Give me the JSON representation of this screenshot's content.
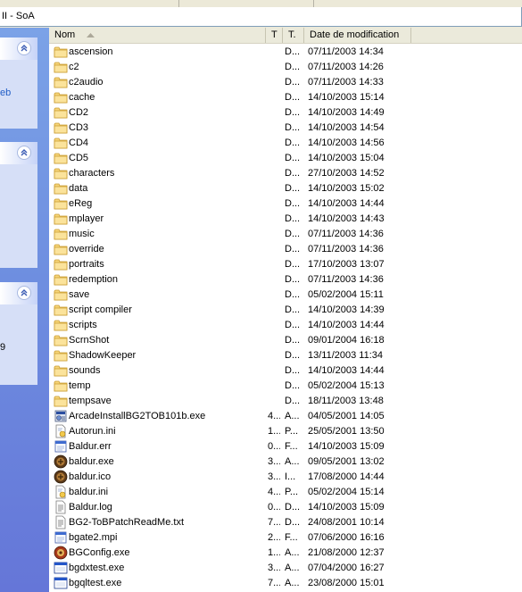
{
  "window": {
    "address_text": "II - SoA"
  },
  "task_pane": {
    "sections": [
      {
        "chevron": "chevron-up-icon",
        "text": "eb"
      },
      {
        "chevron": "chevron-up-icon",
        "text": ""
      },
      {
        "chevron": "chevron-up-icon",
        "text": "9"
      }
    ]
  },
  "columns": {
    "name": "Nom",
    "size": "T",
    "type": "T.",
    "date": "Date de modification"
  },
  "files": [
    {
      "name": "ascension",
      "size": "",
      "type": "D...",
      "date": "07/11/2003 14:34",
      "icon": "folder-icon"
    },
    {
      "name": "c2",
      "size": "",
      "type": "D...",
      "date": "07/11/2003 14:26",
      "icon": "folder-icon"
    },
    {
      "name": "c2audio",
      "size": "",
      "type": "D...",
      "date": "07/11/2003 14:33",
      "icon": "folder-icon"
    },
    {
      "name": "cache",
      "size": "",
      "type": "D...",
      "date": "14/10/2003 15:14",
      "icon": "folder-icon"
    },
    {
      "name": "CD2",
      "size": "",
      "type": "D...",
      "date": "14/10/2003 14:49",
      "icon": "folder-icon"
    },
    {
      "name": "CD3",
      "size": "",
      "type": "D...",
      "date": "14/10/2003 14:54",
      "icon": "folder-icon"
    },
    {
      "name": "CD4",
      "size": "",
      "type": "D...",
      "date": "14/10/2003 14:56",
      "icon": "folder-icon"
    },
    {
      "name": "CD5",
      "size": "",
      "type": "D...",
      "date": "14/10/2003 15:04",
      "icon": "folder-icon"
    },
    {
      "name": "characters",
      "size": "",
      "type": "D...",
      "date": "27/10/2003 14:52",
      "icon": "folder-icon"
    },
    {
      "name": "data",
      "size": "",
      "type": "D...",
      "date": "14/10/2003 15:02",
      "icon": "folder-icon"
    },
    {
      "name": "eReg",
      "size": "",
      "type": "D...",
      "date": "14/10/2003 14:44",
      "icon": "folder-icon"
    },
    {
      "name": "mplayer",
      "size": "",
      "type": "D...",
      "date": "14/10/2003 14:43",
      "icon": "folder-icon"
    },
    {
      "name": "music",
      "size": "",
      "type": "D...",
      "date": "07/11/2003 14:36",
      "icon": "folder-icon"
    },
    {
      "name": "override",
      "size": "",
      "type": "D...",
      "date": "07/11/2003 14:36",
      "icon": "folder-icon"
    },
    {
      "name": "portraits",
      "size": "",
      "type": "D...",
      "date": "17/10/2003 13:07",
      "icon": "folder-icon"
    },
    {
      "name": "redemption",
      "size": "",
      "type": "D...",
      "date": "07/11/2003 14:36",
      "icon": "folder-icon"
    },
    {
      "name": "save",
      "size": "",
      "type": "D...",
      "date": "05/02/2004 15:11",
      "icon": "folder-icon"
    },
    {
      "name": "script compiler",
      "size": "",
      "type": "D...",
      "date": "14/10/2003 14:39",
      "icon": "folder-icon"
    },
    {
      "name": "scripts",
      "size": "",
      "type": "D...",
      "date": "14/10/2003 14:44",
      "icon": "folder-icon"
    },
    {
      "name": "ScrnShot",
      "size": "",
      "type": "D...",
      "date": "09/01/2004 16:18",
      "icon": "folder-icon"
    },
    {
      "name": "ShadowKeeper",
      "size": "",
      "type": "D...",
      "date": "13/11/2003 11:34",
      "icon": "folder-icon"
    },
    {
      "name": "sounds",
      "size": "",
      "type": "D...",
      "date": "14/10/2003 14:44",
      "icon": "folder-icon"
    },
    {
      "name": "temp",
      "size": "",
      "type": "D...",
      "date": "05/02/2004 15:13",
      "icon": "folder-icon"
    },
    {
      "name": "tempsave",
      "size": "",
      "type": "D...",
      "date": "18/11/2003 13:48",
      "icon": "folder-icon"
    },
    {
      "name": "ArcadeInstallBG2TOB101b.exe",
      "size": "4...",
      "type": "A...",
      "date": "04/05/2001 14:05",
      "icon": "installer-icon"
    },
    {
      "name": "Autorun.ini",
      "size": "1...",
      "type": "P...",
      "date": "25/05/2001 13:50",
      "icon": "settings-file-icon"
    },
    {
      "name": "Baldur.err",
      "size": "0...",
      "type": "F...",
      "date": "14/10/2003 15:09",
      "icon": "generic-file-icon"
    },
    {
      "name": "baldur.exe",
      "size": "3...",
      "type": "A...",
      "date": "09/05/2001 13:02",
      "icon": "game-exe-icon"
    },
    {
      "name": "baldur.ico",
      "size": "3...",
      "type": "I...",
      "date": "17/08/2000 14:44",
      "icon": "game-exe-icon"
    },
    {
      "name": "baldur.ini",
      "size": "4...",
      "type": "P...",
      "date": "05/02/2004 15:14",
      "icon": "settings-file-icon"
    },
    {
      "name": "Baldur.log",
      "size": "0...",
      "type": "D...",
      "date": "14/10/2003 15:09",
      "icon": "text-file-icon"
    },
    {
      "name": "BG2-ToBPatchReadMe.txt",
      "size": "7...",
      "type": "D...",
      "date": "24/08/2001 10:14",
      "icon": "text-file-icon"
    },
    {
      "name": "bgate2.mpi",
      "size": "2...",
      "type": "F...",
      "date": "07/06/2000 16:16",
      "icon": "generic-file-icon"
    },
    {
      "name": "BGConfig.exe",
      "size": "1...",
      "type": "A...",
      "date": "21/08/2000 12:37",
      "icon": "config-exe-icon"
    },
    {
      "name": "bgdxtest.exe",
      "size": "3...",
      "type": "A...",
      "date": "07/04/2000 16:27",
      "icon": "window-exe-icon"
    },
    {
      "name": "bgqltest.exe",
      "size": "7...",
      "type": "A...",
      "date": "23/08/2000 15:01",
      "icon": "window-exe-icon"
    }
  ]
}
